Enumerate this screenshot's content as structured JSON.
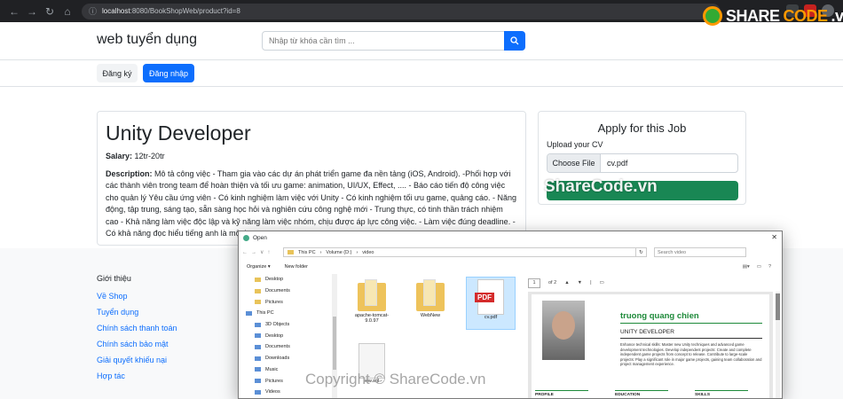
{
  "browser": {
    "url_host": "localhost",
    "url_rest": ":8080/BookShopWeb/product?id=8"
  },
  "site": {
    "brand": "web tuyển dụng",
    "search_placeholder": "Nhập từ khóa cần tìm ...",
    "register": "Đăng ký",
    "login": "Đăng nhập"
  },
  "job": {
    "title": "Unity Developer",
    "salary_label": "Salary:",
    "salary": "12tr-20tr",
    "description_label": "Description:",
    "description": "Mô tả công việc - Tham gia vào các dự án phát triển game đa nền tảng (iOS, Android). -Phối hợp với các thành viên trong team để hoàn thiện và tối ưu game: animation, UI/UX, Effect, .... - Báo cáo tiến độ công việc cho quản lý Yêu cầu ứng viên - Có kinh nghiệm làm việc với Unity - Có kinh nghiệm tối ưu game, quảng cáo. - Năng động, tập trung, sáng tạo, sẵn sàng học hỏi và nghiên cứu công nghệ mới - Trung thực, có tinh thần trách nhiệm cao - Khả năng làm việc độc lập và kỹ năng làm việc nhóm, chịu được áp lực công việc. - Làm việc đúng deadline. - Có khả năng đọc hiểu tiếng anh là một lợ"
  },
  "apply": {
    "title": "Apply for this Job",
    "upload_label": "Upload your CV",
    "choose_file": "Choose File",
    "file_name": "cv.pdf"
  },
  "footer": {
    "title": "Giới thiệu",
    "links": [
      "Về Shop",
      "Tuyển dụng",
      "Chính sách thanh toán",
      "Chính sách bảo mật",
      "Giải quyết khiếu nại",
      "Hợp tác"
    ]
  },
  "watermark": {
    "logo_a": "SHARE",
    "logo_b": "CODE",
    "logo_c": ".vn",
    "center": "ShareCode.vn",
    "bottom": "Copyright © ShareCode.vn"
  },
  "dialog": {
    "title": "Open",
    "path": [
      "This PC",
      "Volume (D:)",
      "video"
    ],
    "search_placeholder": "Search video",
    "organize": "Organize ▾",
    "new_folder": "New folder",
    "tree": [
      {
        "label": "Desktop",
        "kind": "folder"
      },
      {
        "label": "Documents",
        "kind": "folder"
      },
      {
        "label": "Pictures",
        "kind": "folder"
      },
      {
        "label": "This PC",
        "kind": "pc"
      },
      {
        "label": "3D Objects",
        "kind": "pc"
      },
      {
        "label": "Desktop",
        "kind": "pc"
      },
      {
        "label": "Documents",
        "kind": "pc"
      },
      {
        "label": "Downloads",
        "kind": "pc"
      },
      {
        "label": "Music",
        "kind": "pc"
      },
      {
        "label": "Pictures",
        "kind": "pc"
      },
      {
        "label": "Videos",
        "kind": "pc"
      }
    ],
    "files": [
      {
        "label": "apache-tomcat-9.0.97",
        "kind": "folder"
      },
      {
        "label": "WebNew",
        "kind": "folder"
      },
      {
        "label": "cv.pdf",
        "kind": "pdf"
      },
      {
        "label": "ww.sql",
        "kind": "doc"
      }
    ],
    "preview_page": "1",
    "preview_of": "of 2",
    "cv": {
      "name": "truong quang chien",
      "role": "UNITY DEVELOPER",
      "summary": "Enhance technical skills: Master new Unity techniques and advanced game development technologies. Develop independent projects: Create and complete independent game projects from concept to release. Contribute to large-scale projects: Play a significant role in major game projects, gaining team collaboration and project management experience.",
      "sections": [
        "PROFILE",
        "EDUCATION",
        "SKILLS"
      ]
    }
  }
}
